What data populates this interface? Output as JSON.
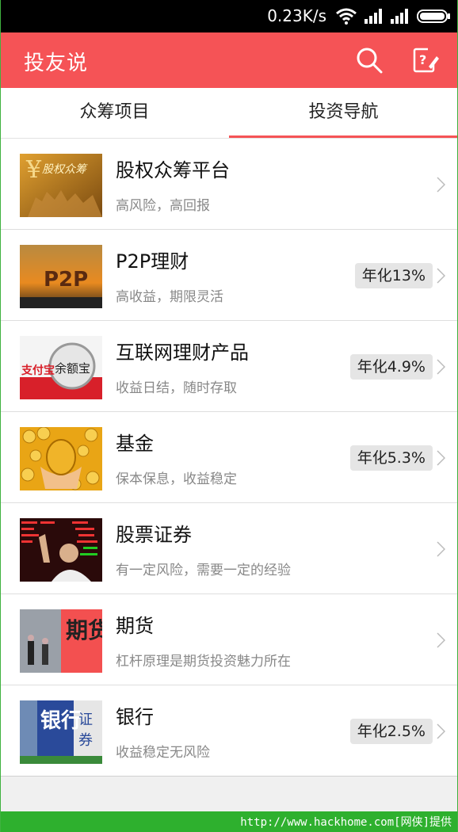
{
  "status_bar": {
    "speed": "0.23K/s",
    "icons": [
      "wifi-icon",
      "signal-icon",
      "signal-icon",
      "battery-icon"
    ]
  },
  "header": {
    "title": "投友说",
    "icons": [
      "search-icon",
      "edit-question-icon"
    ]
  },
  "tabs": [
    {
      "label": "众筹项目",
      "active": false
    },
    {
      "label": "投资导航",
      "active": true
    }
  ],
  "items": [
    {
      "name": "股权众筹平台",
      "desc": "高风险，高回报",
      "badge": "",
      "thumb_text": "股权众筹"
    },
    {
      "name": "P2P理财",
      "desc": "高收益，期限灵活",
      "badge": "年化13%",
      "thumb_text": "P2P"
    },
    {
      "name": "互联网理财产品",
      "desc": "收益日结，随时存取",
      "badge": "年化4.9%",
      "thumb_text": "余额宝"
    },
    {
      "name": "基金",
      "desc": "保本保息，收益稳定",
      "badge": "年化5.3%",
      "thumb_text": ""
    },
    {
      "name": "股票证券",
      "desc": "有一定风险，需要一定的经验",
      "badge": "",
      "thumb_text": ""
    },
    {
      "name": "期货",
      "desc": "杠杆原理是期货投资魅力所在",
      "badge": "",
      "thumb_text": "期货"
    },
    {
      "name": "银行",
      "desc": "收益稳定无风险",
      "badge": "年化2.5%",
      "thumb_text": "银行"
    }
  ],
  "watermark": "http://www.hackhome.com[网侠]提供",
  "colors": {
    "accent": "#f55356",
    "watermark_green": "#2eb02e"
  }
}
